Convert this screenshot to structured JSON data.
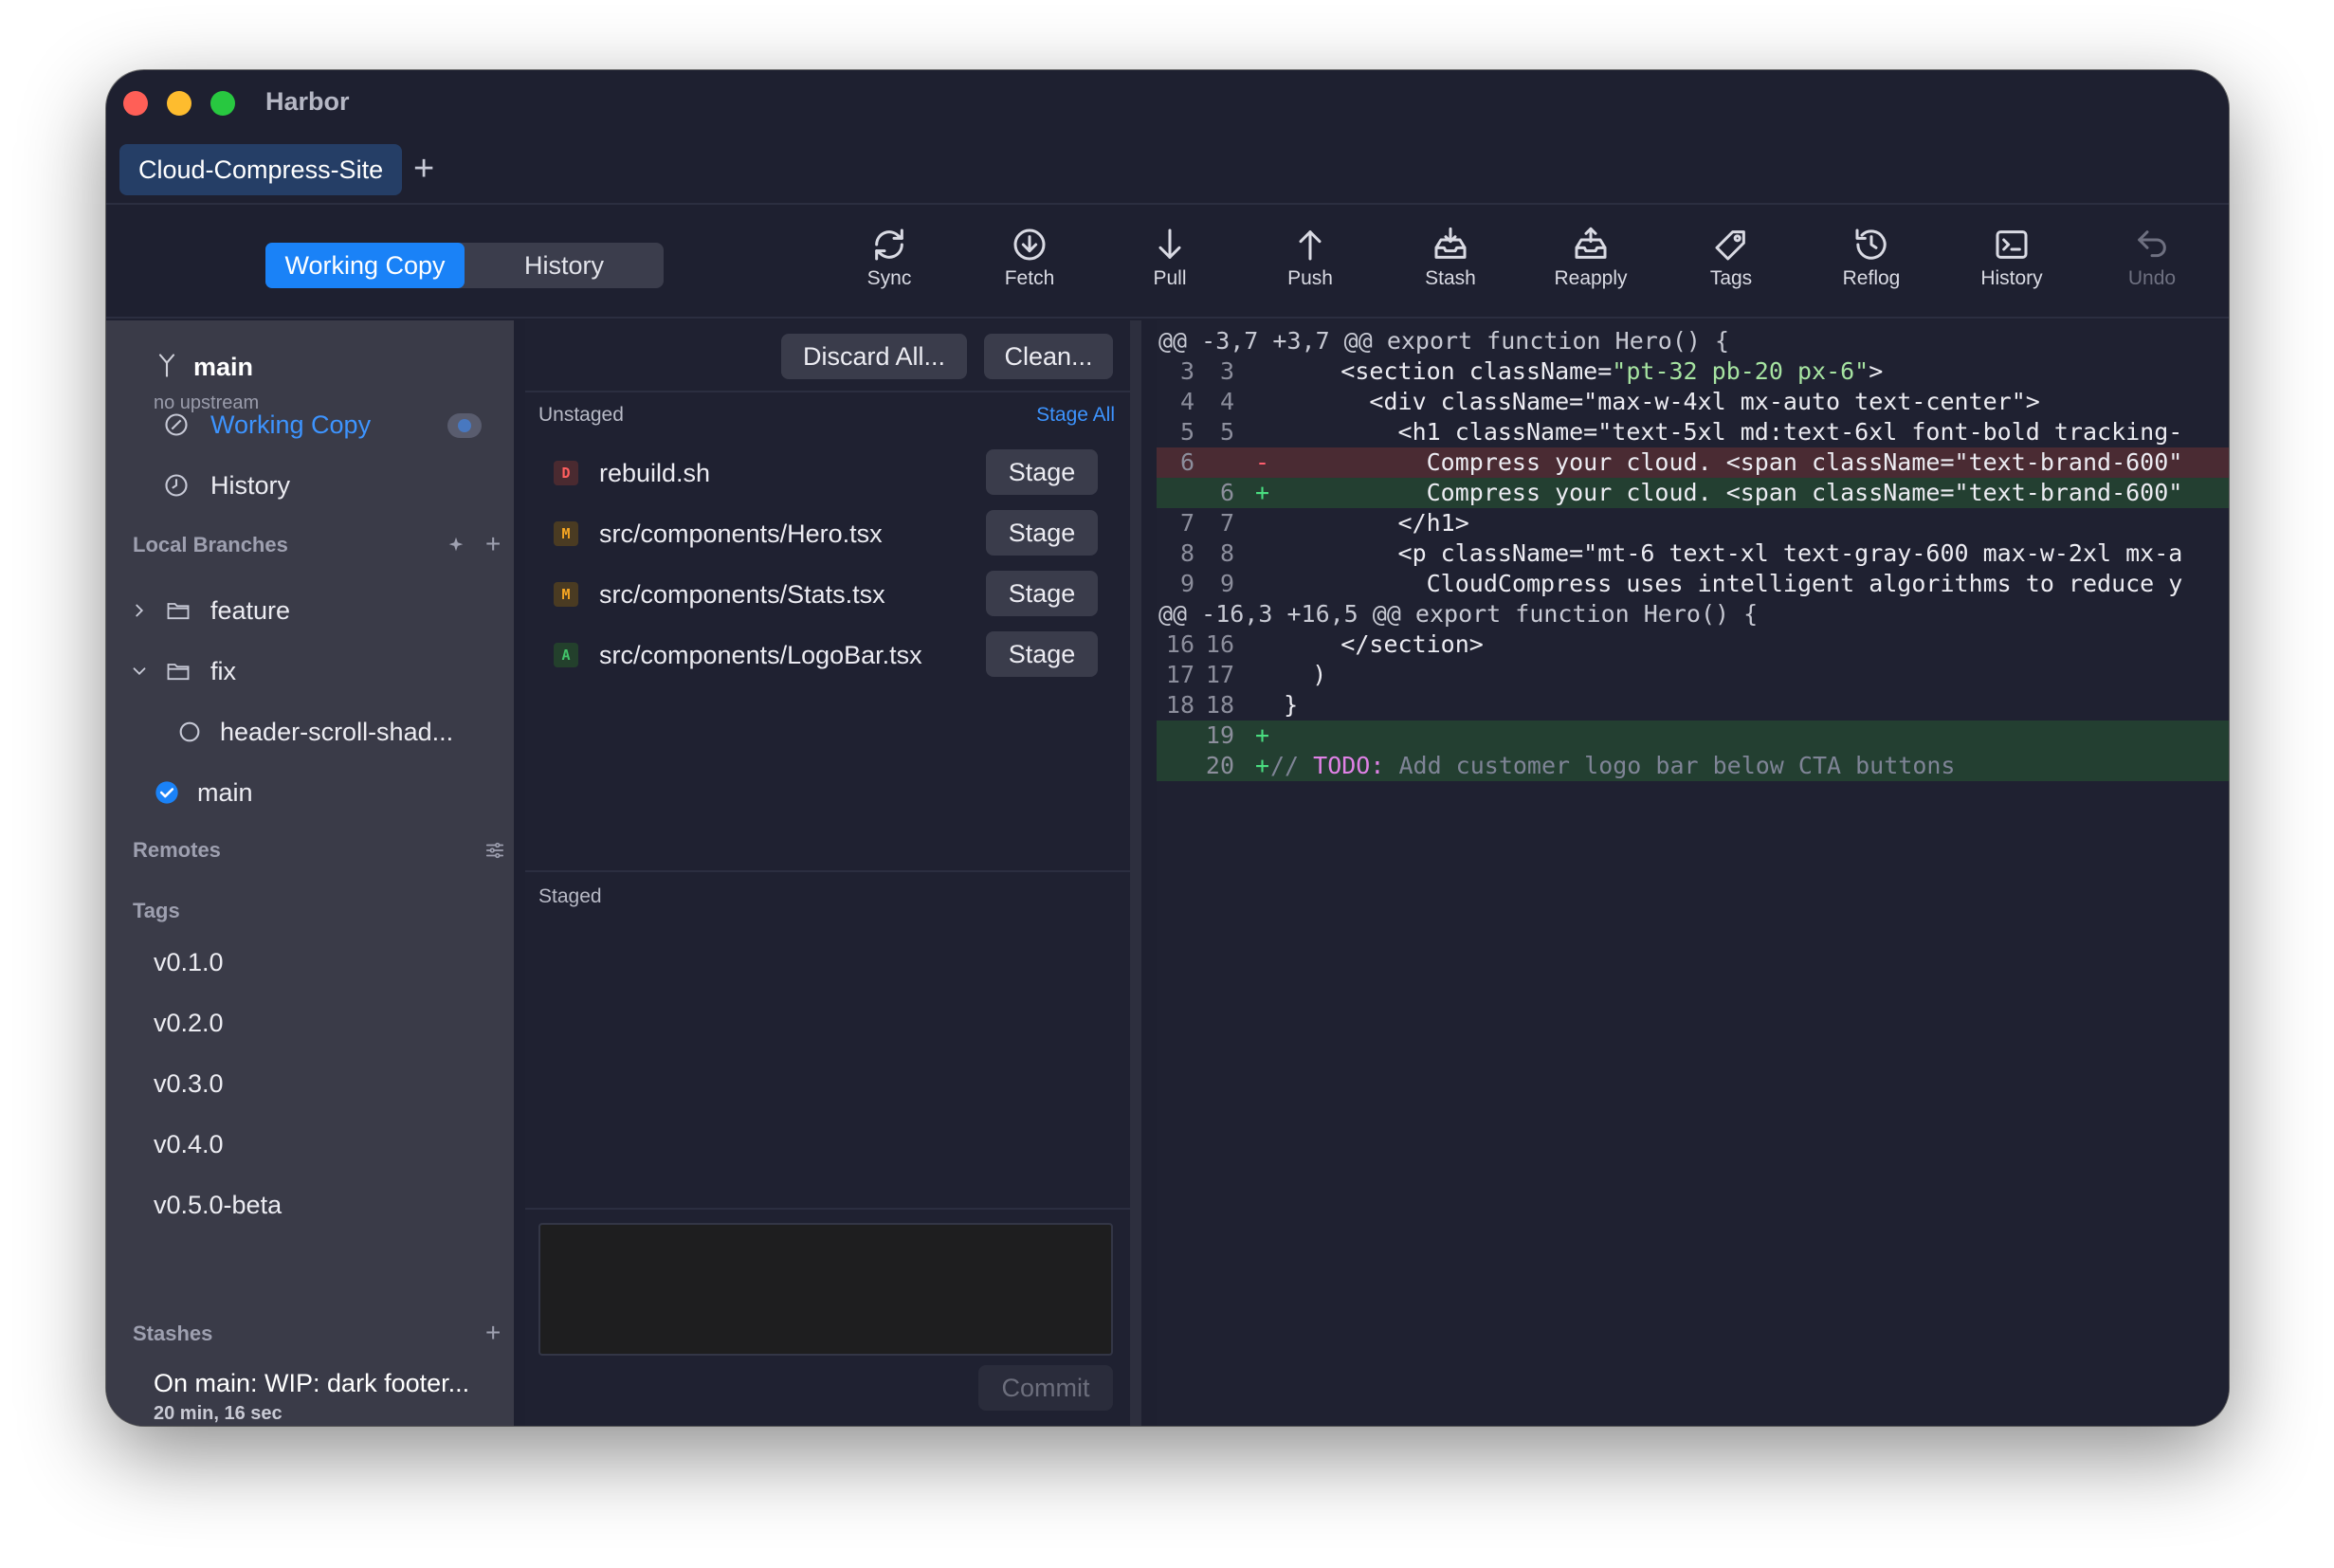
{
  "window": {
    "title": "Harbor"
  },
  "tabs": {
    "repo": "Cloud-Compress-Site",
    "add": "+"
  },
  "toolbar": {
    "segments": [
      "Working Copy",
      "History"
    ],
    "actions": [
      {
        "label": "Sync",
        "icon": "sync-icon"
      },
      {
        "label": "Fetch",
        "icon": "fetch-icon"
      },
      {
        "label": "Pull",
        "icon": "pull-icon"
      },
      {
        "label": "Push",
        "icon": "push-icon"
      },
      {
        "label": "Stash",
        "icon": "stash-icon"
      },
      {
        "label": "Reapply",
        "icon": "reapply-icon"
      },
      {
        "label": "Tags",
        "icon": "tag-icon"
      },
      {
        "label": "Reflog",
        "icon": "reflog-icon"
      },
      {
        "label": "History",
        "icon": "terminal-icon"
      },
      {
        "label": "Undo",
        "icon": "undo-icon"
      }
    ]
  },
  "sidebar": {
    "branch": "main",
    "upstream": "no upstream",
    "nav": [
      {
        "label": "Working Copy",
        "icon": "working-copy-icon",
        "active": true
      },
      {
        "label": "History",
        "icon": "clock-icon",
        "active": false
      }
    ],
    "local_branches_title": "Local Branches",
    "folders": [
      {
        "label": "feature",
        "expanded": false
      },
      {
        "label": "fix",
        "expanded": true
      }
    ],
    "branches": [
      {
        "label": "header-scroll-shad...",
        "current": false
      },
      {
        "label": "main",
        "current": true
      }
    ],
    "remotes_title": "Remotes",
    "tags_title": "Tags",
    "tags": [
      "v0.1.0",
      "v0.2.0",
      "v0.3.0",
      "v0.4.0",
      "v0.5.0-beta"
    ],
    "stashes_title": "Stashes",
    "stash": {
      "title": "On main: WIP: dark footer...",
      "time": "20 min, 16 sec"
    }
  },
  "changes": {
    "discard_all": "Discard All...",
    "clean": "Clean...",
    "unstaged_title": "Unstaged",
    "stage_all": "Stage All",
    "stage_label": "Stage",
    "files": [
      {
        "status": "D",
        "path": "rebuild.sh"
      },
      {
        "status": "M",
        "path": "src/components/Hero.tsx"
      },
      {
        "status": "M",
        "path": "src/components/Stats.tsx"
      },
      {
        "status": "A",
        "path": "src/components/LogoBar.tsx"
      }
    ],
    "staged_title": "Staged",
    "commit_label": "Commit"
  },
  "diff": {
    "hunk1": "@@ -3,7 +3,7 @@ export function Hero() {",
    "hunk2": "@@ -16,3 +16,5 @@ export function Hero() {",
    "lines": [
      {
        "old": "3",
        "new": "3",
        "sign": "",
        "pre": "      <section className=",
        "str": "\"pt-32 pb-20 px-6\"",
        "post": ">"
      },
      {
        "old": "4",
        "new": "4",
        "sign": "",
        "pre": "        <div className=\"max-w-4xl mx-auto text-center\">",
        "str": "",
        "post": ""
      },
      {
        "old": "5",
        "new": "5",
        "sign": "",
        "pre": "          <h1 className=\"text-5xl md:text-6xl font-bold tracking-",
        "str": "",
        "post": ""
      },
      {
        "old": "6",
        "new": "",
        "sign": "-",
        "pre": "            Compress your cloud. <span className=\"text-brand-600\"",
        "str": "",
        "post": ""
      },
      {
        "old": "",
        "new": "6",
        "sign": "+",
        "pre": "            Compress your cloud. <span className=\"text-brand-600\"",
        "str": "",
        "post": ""
      },
      {
        "old": "7",
        "new": "7",
        "sign": "",
        "pre": "          </h1>",
        "str": "",
        "post": ""
      },
      {
        "old": "8",
        "new": "8",
        "sign": "",
        "pre": "          <p className=\"mt-6 text-xl text-gray-600 max-w-2xl mx-a",
        "str": "",
        "post": ""
      },
      {
        "old": "9",
        "new": "9",
        "sign": "",
        "pre": "            CloudCompress uses intelligent algorithms to reduce y",
        "str": "",
        "post": ""
      }
    ],
    "lines2": [
      {
        "old": "16",
        "new": "16",
        "sign": "",
        "text": "      </section>"
      },
      {
        "old": "17",
        "new": "17",
        "sign": "",
        "text": "    )"
      },
      {
        "old": "18",
        "new": "18",
        "sign": "",
        "text": "  }"
      },
      {
        "old": "",
        "new": "19",
        "sign": "+",
        "text": ""
      },
      {
        "old": "",
        "new": "20",
        "sign": "+",
        "comment": "// ",
        "todo": "TODO:",
        "rest": " Add customer logo bar below CTA buttons"
      }
    ]
  },
  "colors": {
    "accent": "#1a82f7",
    "deleted": "#ff5e5e",
    "modified": "#f6a623",
    "added": "#42c46a"
  }
}
